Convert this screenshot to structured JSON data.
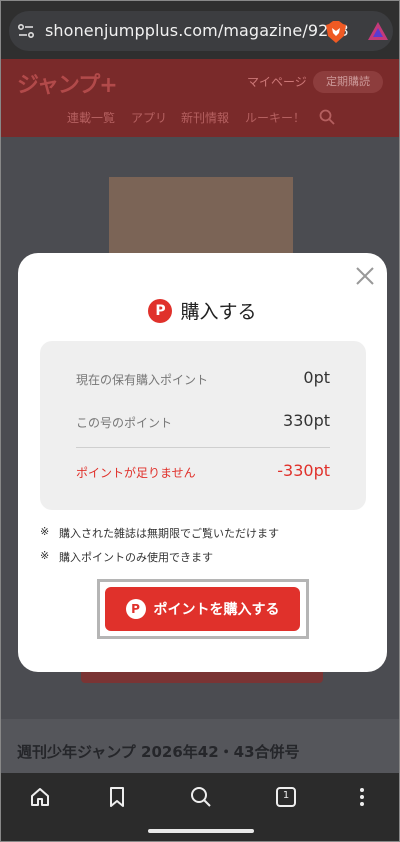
{
  "browser": {
    "url": "shonenjumpplus.com/magazine/9253"
  },
  "site": {
    "logo": "ジャンプ+",
    "mypage": "マイページ",
    "subscribe": "定期購読",
    "nav": [
      "連載一覧",
      "アプリ",
      "新刊情報",
      "ルーキー！"
    ],
    "issue_title": "週刊少年ジャンプ 2026年42・43合併号"
  },
  "modal": {
    "badge": "P",
    "title": "購入する",
    "points": {
      "held_label": "現在の保有購入ポイント",
      "held_value": "0pt",
      "issue_label": "この号のポイント",
      "issue_value": "330pt",
      "short_label": "ポイントが足りません",
      "short_value": "-330pt"
    },
    "notes": [
      {
        "mark": "※",
        "text": "購入された雑誌は無期限でご覧いただけます"
      },
      {
        "mark": "※",
        "text": "購入ポイントのみ使用できます"
      }
    ],
    "buy_button": {
      "badge": "P",
      "label": "ポイントを購入する"
    }
  },
  "bottom_nav": {
    "tab_count": "1"
  },
  "colors": {
    "accent": "#e0312b",
    "modal_bg": "#ffffff",
    "box_bg": "#efefef"
  }
}
